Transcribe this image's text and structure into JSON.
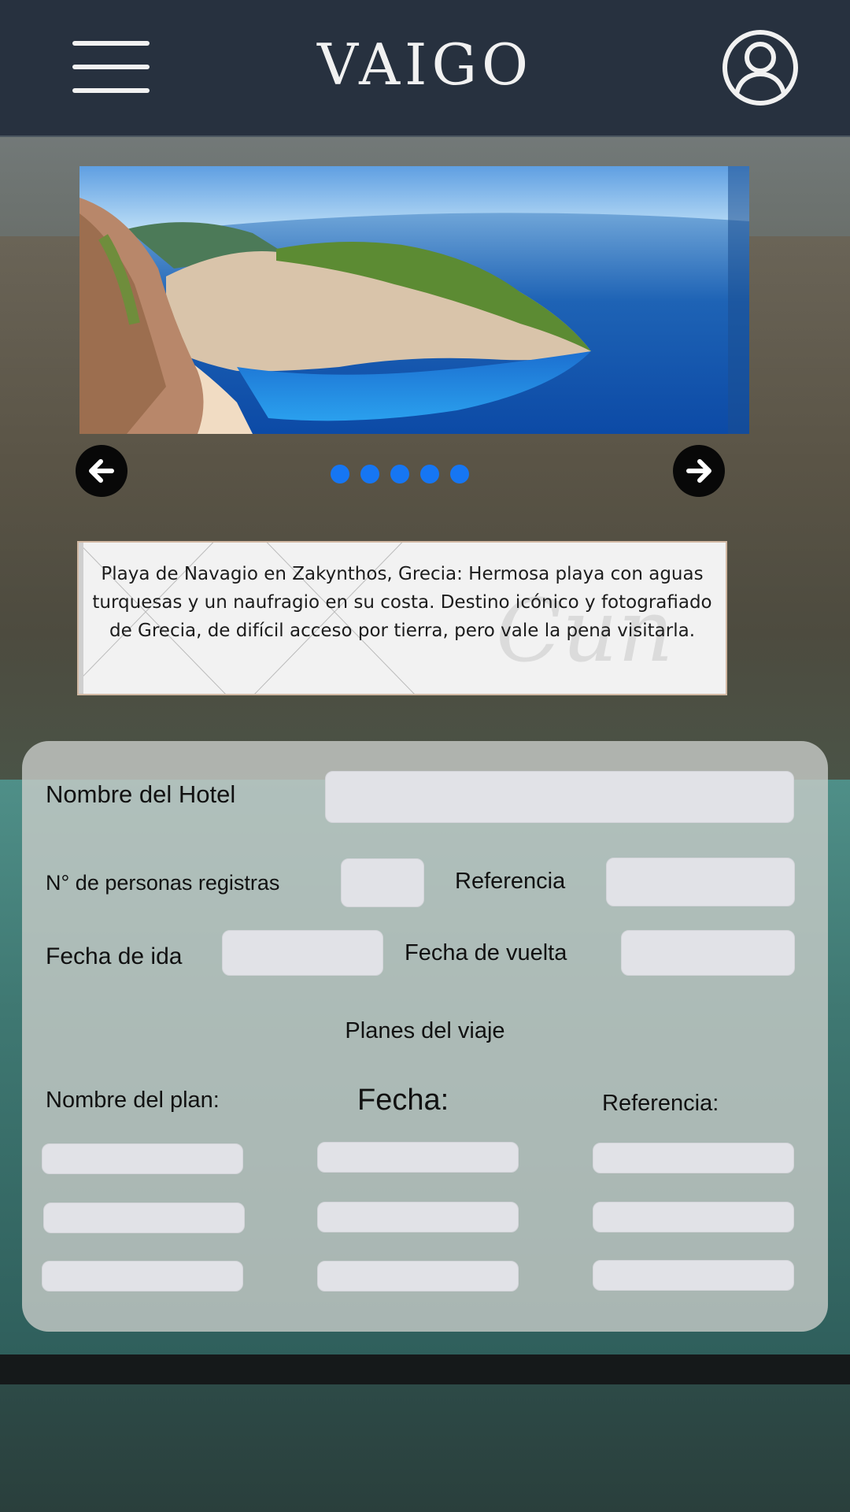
{
  "header": {
    "logo": "VAIGO",
    "menu_icon": "hamburger-menu-icon",
    "profile_icon": "user-profile-icon"
  },
  "carousel": {
    "image_description": "Navagio beach, Zakynthos",
    "slide_count": 5,
    "active_color": "#1676f3",
    "prev_icon": "arrow-left-icon",
    "next_icon": "arrow-right-icon"
  },
  "description": {
    "text": "Playa de Navagio en Zakynthos, Grecia: Hermosa playa con aguas turquesas y un naufragio en su costa. Destino icónico y fotografiado de Grecia, de difícil acceso por tierra, pero vale la pena visitarla."
  },
  "form": {
    "hotel_label": "Nombre del Hotel",
    "persons_label": "N°  de personas registras",
    "reference_label": "Referencia",
    "departure_label": "Fecha de ida",
    "return_label": "Fecha de vuelta",
    "plans_title": "Planes del viaje",
    "plan_name_header": "Nombre del plan:",
    "plan_date_header": "Fecha:",
    "plan_ref_header": "Referencia:",
    "values": {
      "hotel": "",
      "persons": "",
      "reference": "",
      "departure": "",
      "return": ""
    }
  },
  "colors": {
    "header_bg": "#27313f",
    "panel_bg": "#c8ccc8",
    "input_bg": "#e1e2e7",
    "dot_color": "#1676f3"
  }
}
